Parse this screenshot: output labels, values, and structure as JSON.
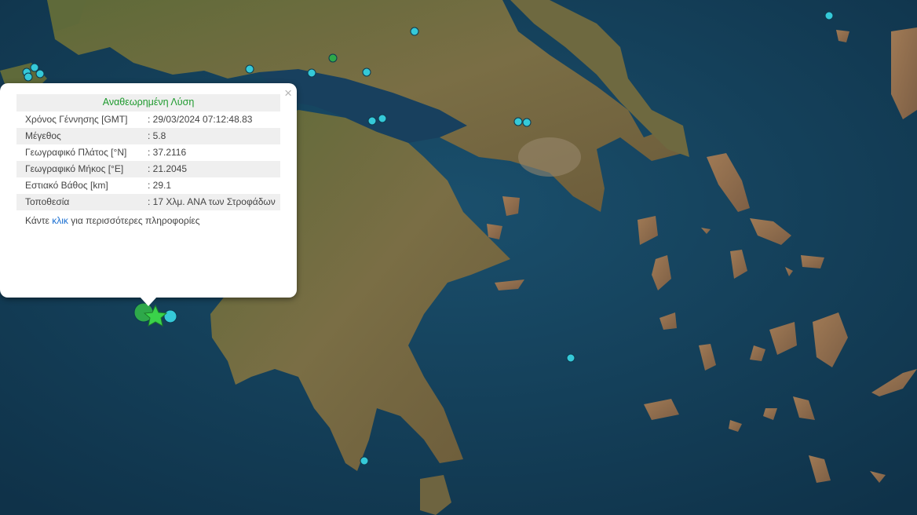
{
  "popup": {
    "title": "Αναθεωρημένη Λύση",
    "close_glyph": "×",
    "rows": [
      {
        "label": "Χρόνος Γέννησης [GMT]",
        "value": ": 29/03/2024 07:12:48.83"
      },
      {
        "label": "Μέγεθος",
        "value": ": 5.8"
      },
      {
        "label": "Γεωγραφικό Πλάτος [°N]",
        "value": ": 37.2116"
      },
      {
        "label": "Γεωγραφικό Μήκος [°E]",
        "value": ": 21.2045"
      },
      {
        "label": "Εστιακό Βάθος [km]",
        "value": ": 29.1"
      },
      {
        "label": "Τοποθεσία",
        "value": ": 17 Χλμ. ΑΝΑ των Στροφάδων"
      }
    ],
    "more_prefix": "Κάντε ",
    "more_link": "κλικ",
    "more_suffix": " για περισσότερες πληροφορίες"
  },
  "colors": {
    "sea": "#123d57",
    "land": "#6b6a3c",
    "epicenter_star": "#3ad24a",
    "quake_marker": "#35c9d8",
    "quake_marker_green": "#2ea84a"
  },
  "markers": {
    "epicenter": "star-icon",
    "recent": "circle-icon"
  }
}
